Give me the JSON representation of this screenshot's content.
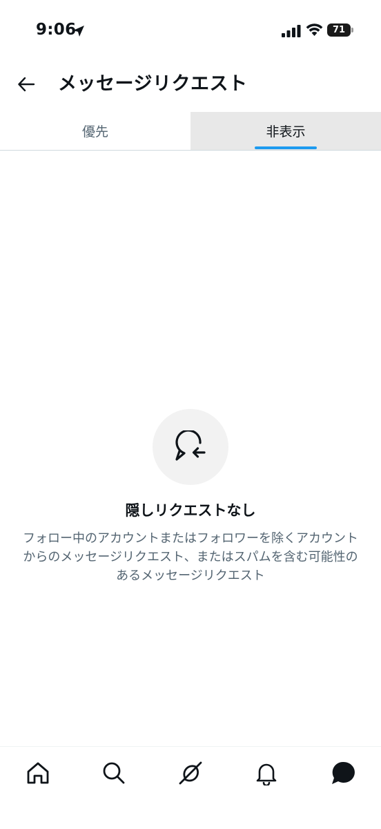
{
  "status_bar": {
    "time": "9:06",
    "battery_level": "71",
    "icons": [
      "location-icon",
      "signal-icon",
      "wifi-icon",
      "battery-icon"
    ]
  },
  "header": {
    "back_icon": "arrow-left-icon",
    "title": "メッセージリクエスト"
  },
  "tabs": [
    {
      "label": "優先",
      "selected": false
    },
    {
      "label": "非表示",
      "selected": true
    }
  ],
  "empty_state": {
    "icon": "message-return-icon",
    "title": "隠しリクエストなし",
    "description": "フォロー中のアカウントまたはフォロワーを除くアカウントからのメッセージリクエスト、またはスパムを含む可能性のあるメッセージリクエスト"
  },
  "bottom_nav": {
    "items": [
      "home-icon",
      "search-icon",
      "grok-icon",
      "notifications-icon",
      "messages-icon"
    ],
    "active": "messages-icon"
  },
  "colors": {
    "accent": "#1d9bf0",
    "text_primary": "#0f1419",
    "text_secondary": "#536471",
    "selected_tab_bg": "#e8e8e8"
  }
}
